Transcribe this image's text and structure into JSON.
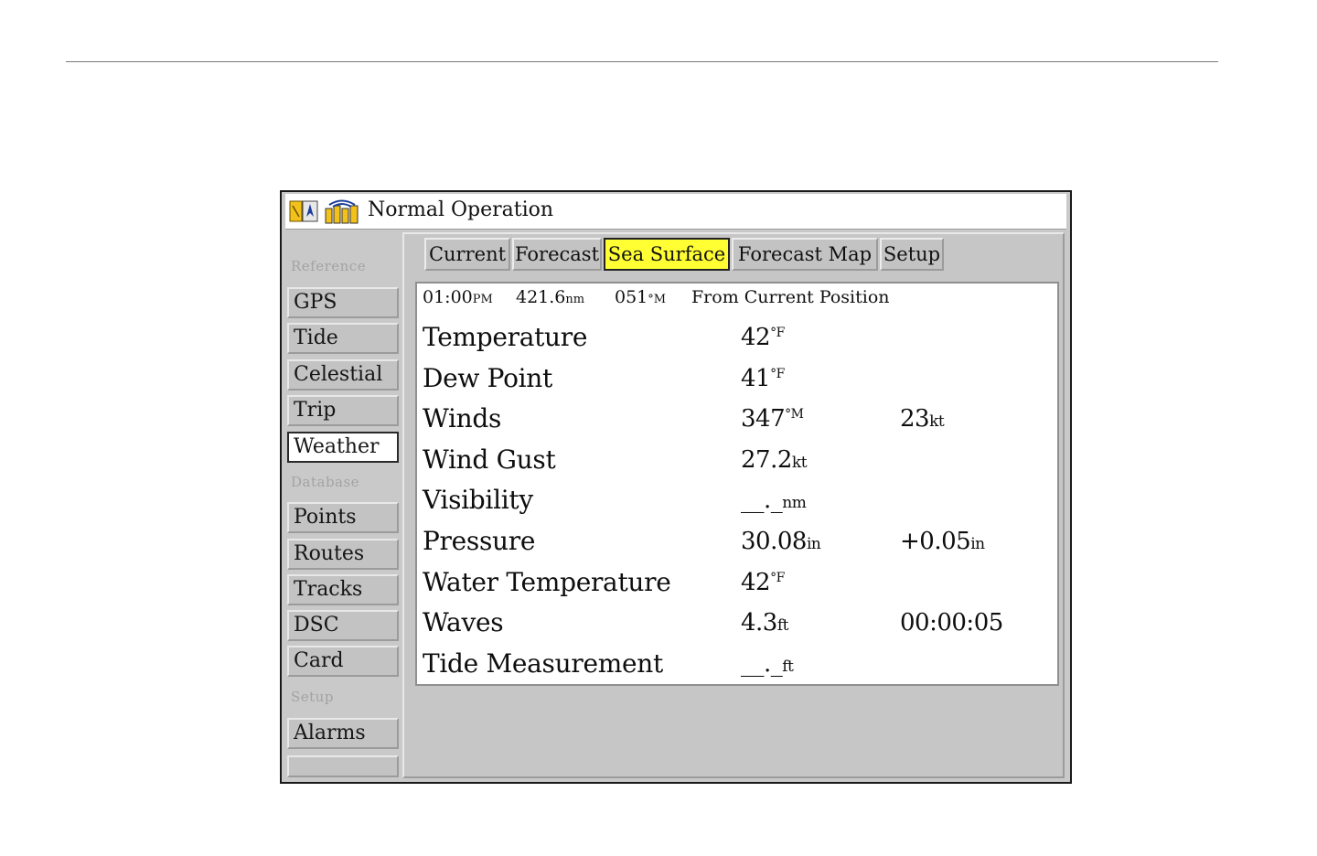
{
  "title_bar": {
    "label": "Normal Operation",
    "icons": [
      "navigation-status-icon",
      "signal-strength-icon"
    ]
  },
  "sidebar": {
    "sections": [
      {
        "label": "Reference",
        "items": [
          "GPS",
          "Tide",
          "Celestial",
          "Trip",
          "Weather"
        ]
      },
      {
        "label": "Database",
        "items": [
          "Points",
          "Routes",
          "Tracks",
          "DSC",
          "Card"
        ]
      },
      {
        "label": "Setup",
        "items": [
          "Alarms"
        ]
      }
    ],
    "active_item": "Weather"
  },
  "tabs": [
    "Current",
    "Forecast",
    "Sea Surface",
    "Forecast Map",
    "Setup"
  ],
  "selected_tab": "Sea Surface",
  "info_line": {
    "time": "01:00",
    "time_suffix": "PM",
    "distance": "421.6",
    "distance_unit": "nm",
    "bearing": "051",
    "bearing_unit": "°M",
    "reference": "From Current Position"
  },
  "rows": [
    {
      "label": "Temperature",
      "value1": "42",
      "unit1": "°F",
      "value2": "",
      "unit2": ""
    },
    {
      "label": "Dew Point",
      "value1": "41",
      "unit1": "°F",
      "value2": "",
      "unit2": ""
    },
    {
      "label": "Winds",
      "value1": "347",
      "unit1": "°M",
      "value2": "23",
      "unit2": "kt"
    },
    {
      "label": "Wind Gust",
      "value1": "27.2",
      "unit1": "kt",
      "value2": "",
      "unit2": ""
    },
    {
      "label": "Visibility",
      "value1": "__._",
      "unit1": "nm",
      "value2": "",
      "unit2": ""
    },
    {
      "label": "Pressure",
      "value1": "30.08",
      "unit1": "in",
      "value2": "+0.05",
      "unit2": "in"
    },
    {
      "label": "Water Temperature",
      "value1": "42",
      "unit1": "°F",
      "value2": "",
      "unit2": ""
    },
    {
      "label": "Waves",
      "value1": "4.3",
      "unit1": "ft",
      "value2": "00:00:05",
      "unit2": ""
    },
    {
      "label": "Tide Measurement",
      "value1": "__._",
      "unit1": "ft",
      "value2": "",
      "unit2": ""
    }
  ],
  "colors": {
    "selected_tab": "#ffff33",
    "panel": "#c6c6c6",
    "content_bg": "#ffffff",
    "frame": "#1a1a1a"
  }
}
